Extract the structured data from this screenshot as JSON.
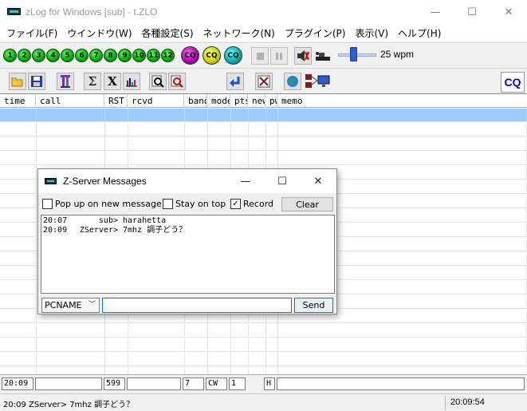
{
  "window": {
    "title": "zLog for Windows  [sub] - t.ZLO",
    "minimize": "—",
    "maximize": "☐",
    "close": "✕"
  },
  "menu": [
    "ファイル(F)",
    "ウインドウ(W)",
    "各種設定(S)",
    "ネットワーク(N)",
    "プラグイン(P)",
    "表示(V)",
    "ヘルプ(H)"
  ],
  "toolbar": {
    "function_keys": [
      "1",
      "2",
      "3",
      "4",
      "5",
      "6",
      "7",
      "8",
      "9",
      "10",
      "11",
      "12"
    ],
    "cq_buttons": [
      "CQ",
      "CQ",
      "CQ"
    ],
    "wpm_label": "25 wpm",
    "wpm_value": 25,
    "cq_mode": "CQ",
    "colors": {
      "fkey": "#00aa00",
      "cq1": "#aa00aa",
      "cq2": "#cccc00",
      "cq3": "#00aaaa",
      "accent": "#0000e0"
    }
  },
  "grid": {
    "columns": [
      "time",
      "call",
      "RST",
      "rcvd",
      "band",
      "mode",
      "pts",
      "new",
      "pwr",
      "memo"
    ],
    "selected_color": "#99ccff"
  },
  "entry": {
    "time": "20:09",
    "call": "",
    "rst": "599",
    "rcvd": "",
    "band": "7",
    "mode": "CW",
    "power": "1",
    "h_label": "H",
    "memo": ""
  },
  "status": {
    "message": "20:09  ZServer> 7mhz 調子どう？",
    "clock": "20:09:54"
  },
  "dialog": {
    "title": "Z-Server Messages",
    "minimize": "—",
    "maximize": "☐",
    "close": "✕",
    "popup_label": "Pop up on new message",
    "popup_checked": false,
    "stay_label": "Stay on top",
    "stay_checked": false,
    "record_label": "Record",
    "record_checked": true,
    "check_mark": "✓",
    "clear_label": "Clear",
    "messages": [
      {
        "time": "20:07",
        "from": "sub>",
        "text": "harahetta"
      },
      {
        "time": "20:09",
        "from": "ZServer>",
        "text": "7mhz 調子どう？"
      }
    ],
    "target": "PCNAME",
    "send_text": "",
    "send_label": "Send"
  }
}
